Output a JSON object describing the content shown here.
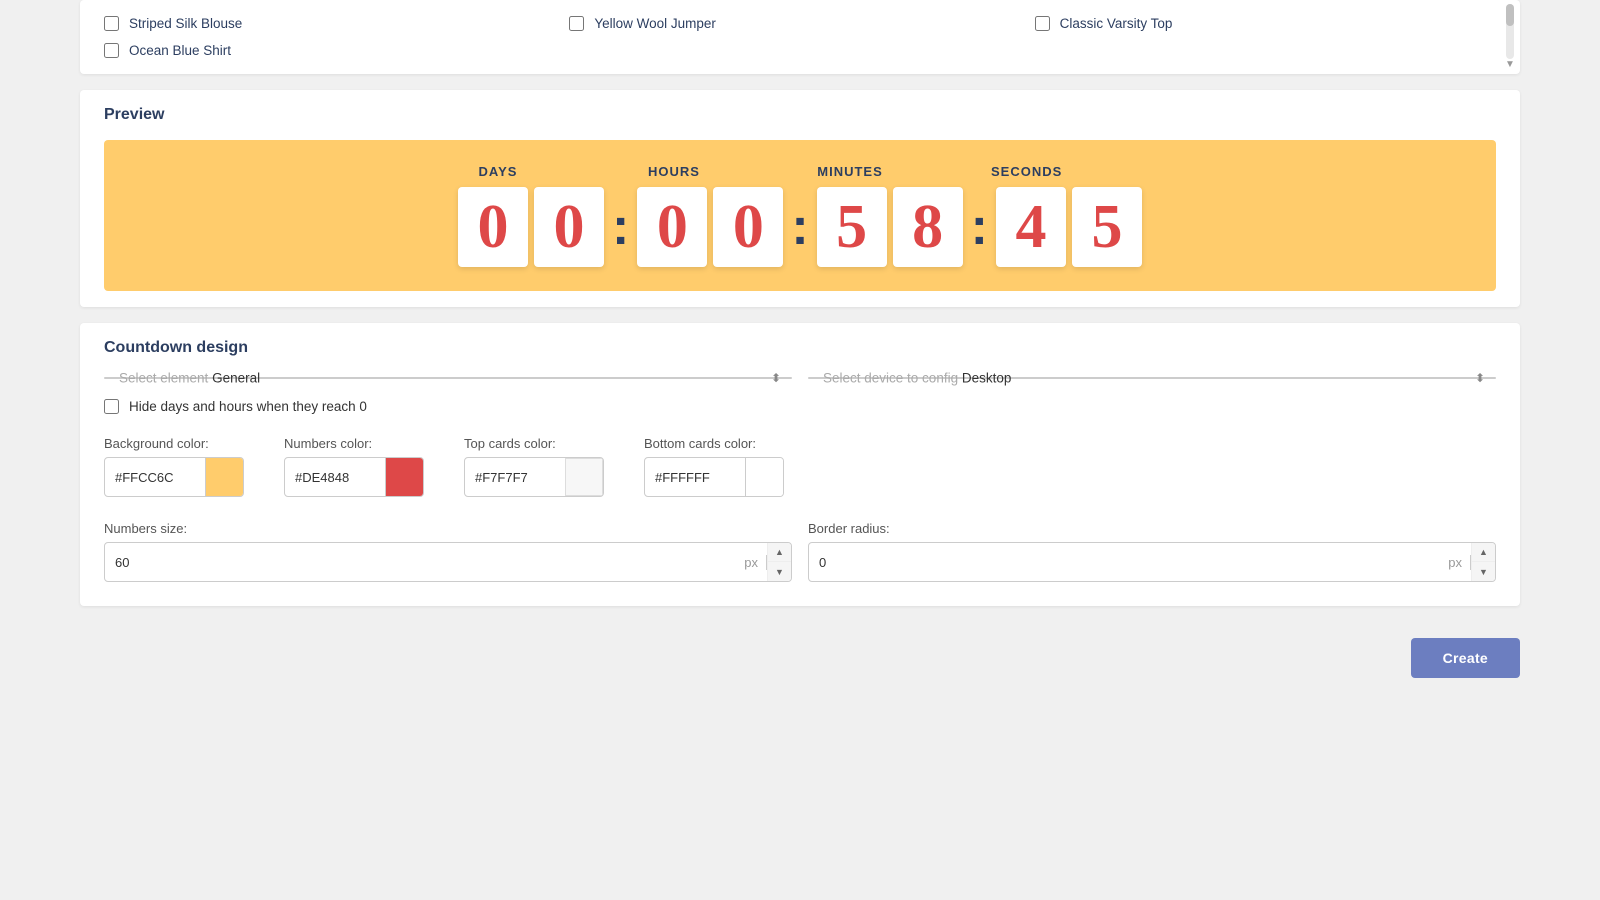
{
  "checkboxes": {
    "items": [
      {
        "id": "striped-silk-blouse",
        "label": "Striped Silk Blouse",
        "checked": false
      },
      {
        "id": "yellow-wool-jumper",
        "label": "Yellow Wool Jumper",
        "checked": false
      },
      {
        "id": "classic-varsity-top",
        "label": "Classic Varsity Top",
        "checked": false
      },
      {
        "id": "ocean-blue-shirt",
        "label": "Ocean Blue Shirt",
        "checked": false
      }
    ]
  },
  "preview": {
    "title": "Preview",
    "countdown": {
      "labels": [
        "DAYS",
        "HOURS",
        "MINUTES",
        "SECONDS"
      ],
      "digits": [
        "0",
        "0",
        "0",
        "0",
        "5",
        "8",
        "4",
        "5"
      ]
    }
  },
  "design": {
    "title": "Countdown design",
    "select_element_label": "Select element",
    "select_element_value": "General",
    "select_device_label": "Select device to config",
    "select_device_value": "Desktop",
    "hide_days_label": "Hide days and hours when they reach 0",
    "bg_color_label": "Background color:",
    "bg_color_hex": "#FFCC6C",
    "bg_color_swatch": "#FFCC6C",
    "numbers_color_label": "Numbers color:",
    "numbers_color_hex": "#DE4848",
    "numbers_color_swatch": "#DE4848",
    "top_cards_color_label": "Top cards color:",
    "top_cards_color_hex": "#F7F7F7",
    "top_cards_color_swatch": "#F7F7F7",
    "bottom_cards_color_label": "Bottom cards color:",
    "bottom_cards_color_hex": "#FFFFFF",
    "bottom_cards_color_swatch": "#FFFFFF",
    "numbers_size_label": "Numbers size:",
    "numbers_size_value": "60",
    "numbers_size_unit": "px",
    "border_radius_label": "Border radius:",
    "border_radius_value": "0",
    "border_radius_unit": "px"
  },
  "buttons": {
    "create_label": "Create"
  }
}
